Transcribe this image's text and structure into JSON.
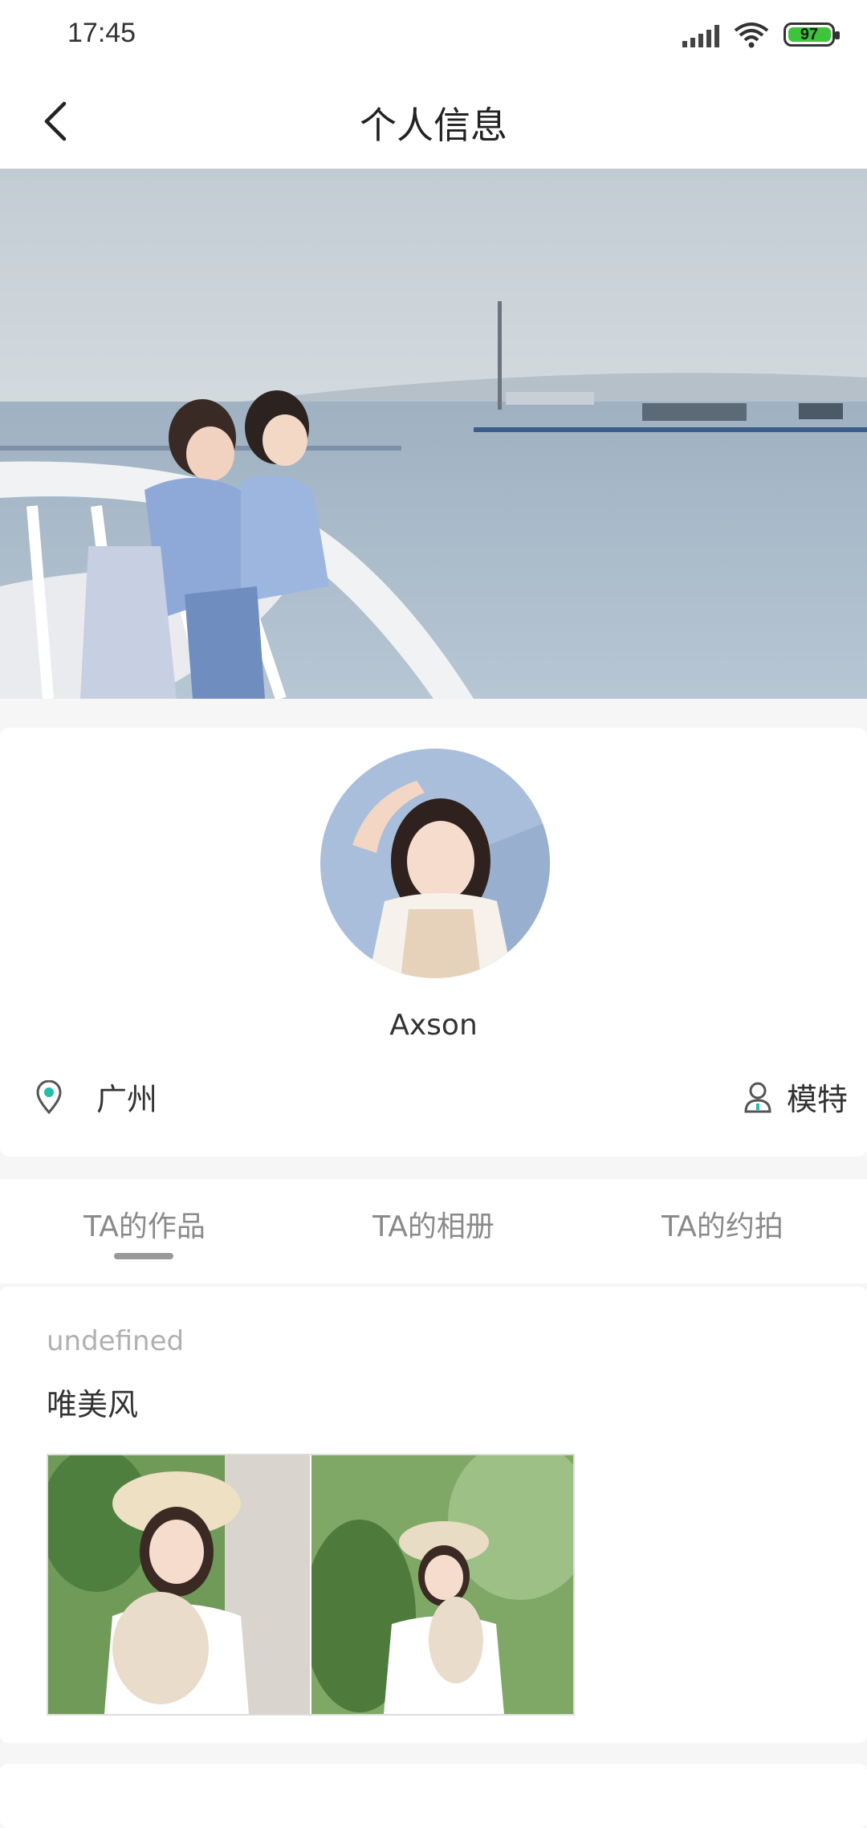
{
  "status_bar": {
    "time": "17:45",
    "battery_level": "97"
  },
  "header": {
    "title": "个人信息",
    "back_icon": "chevron-left-icon"
  },
  "profile": {
    "username": "Axson",
    "location": "广州",
    "role": "模特",
    "location_icon": "map-pin-icon",
    "role_icon": "user-icon"
  },
  "tabs": [
    {
      "label": "TA的作品",
      "active": true
    },
    {
      "label": "TA的相册",
      "active": false
    },
    {
      "label": "TA的约拍",
      "active": false
    }
  ],
  "album": {
    "date": "undefined",
    "title": "唯美风"
  },
  "colors": {
    "accent_teal": "#1fbfa8",
    "battery_green": "#3ec43a",
    "tab_text": "#8a8a8a",
    "background": "#f6f6f6"
  }
}
